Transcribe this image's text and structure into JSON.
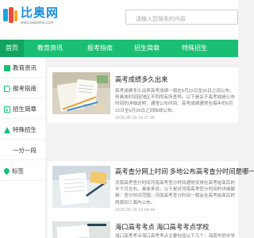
{
  "header": {
    "logo_name": "比奥网",
    "logo_sub": "www.biaoshiu.com",
    "search_placeholder": "请输入您搜索的内容"
  },
  "nav": {
    "items": [
      {
        "label": "首页",
        "active": true
      },
      {
        "label": "教育资讯",
        "active": false
      },
      {
        "label": "报考指南",
        "active": false
      },
      {
        "label": "招生简章",
        "active": false
      },
      {
        "label": "特殊招生",
        "active": false
      }
    ]
  },
  "sidebar": {
    "items": [
      {
        "label": "教育资讯",
        "icon": "grid-icon"
      },
      {
        "label": "报考指南",
        "icon": "bookmark-icon"
      },
      {
        "label": "招生简章",
        "icon": "document-icon"
      },
      {
        "label": "特殊招生",
        "icon": "star-icon"
      },
      {
        "label": "一分一段",
        "icon": ""
      },
      {
        "label": "标签",
        "icon": "tag-icon"
      }
    ]
  },
  "articles": [
    {
      "title": "高考成绩多久出来",
      "desc": "高考成绩多久出来高考成绩一般在6月22日至26日之间公布。但具体时间因地区不同而有所差异。以下是关于高考成绩公布时间的详细说明：通常公布时间：高考成绩通常在每年的6月22日至6月26日之间陆续公布。",
      "time": "2025-08-16 16:37:36"
    },
    {
      "title": "高考查分网上时间 多地公布高考查分时间是哪一天",
      "desc": "河南高考查分时间河南高考查分时间通常安排在高考结束后的半个月左右。具体来说，以下是对河南高考查分时间的详细解释：查分时间范围：河南高考查分时间一般会在高考结束后的两周到三周内公布。",
      "time": "2025-08-16 15:04:44"
    },
    {
      "title": "海口高考考点 海口高考考点学校",
      "desc": "海口高考考点海口高考考点主要包括以下几个：海南华侨中学考点等",
      "time": "2025-08-16"
    }
  ]
}
